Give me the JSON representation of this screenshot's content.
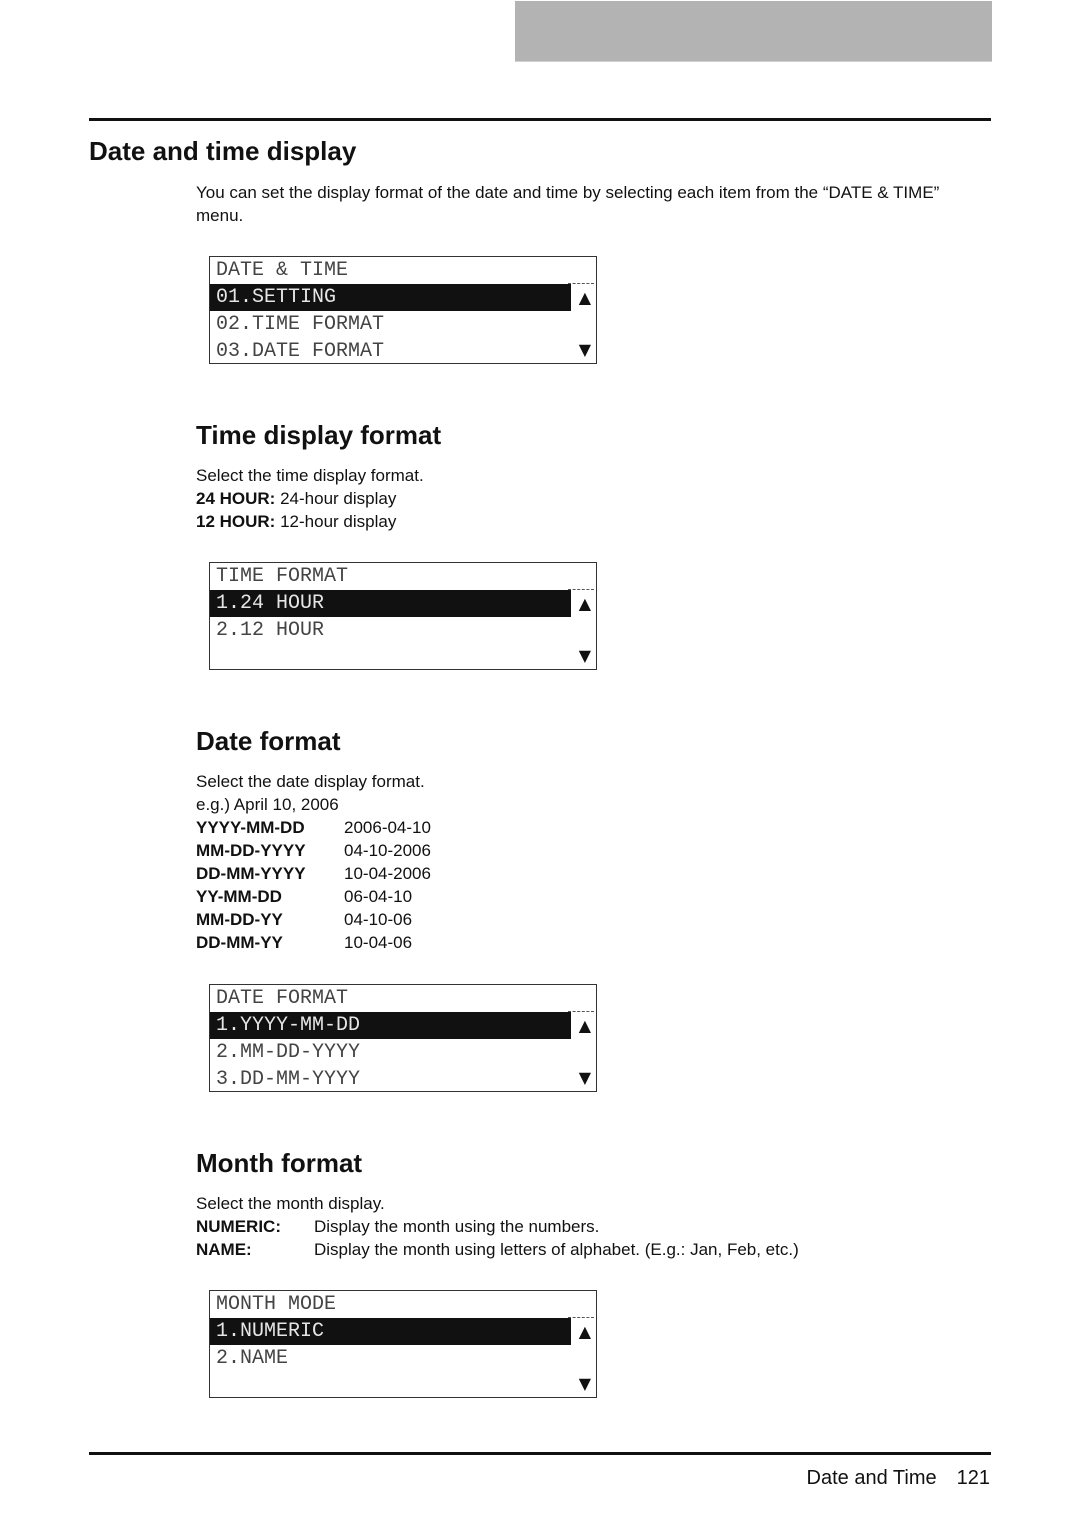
{
  "header": {
    "rule": true
  },
  "section1": {
    "title": "Date and time display",
    "intro": "You can set the display format of the date and time by selecting each item from the “DATE & TIME” menu.",
    "lcd": {
      "title": "DATE & TIME",
      "rows": [
        "01.SETTING",
        "02.TIME FORMAT",
        "03.DATE FORMAT"
      ],
      "selected_index": 0
    }
  },
  "section2": {
    "title": "Time display format",
    "desc": "Select the time display format.",
    "items": [
      {
        "key": "24 HOUR:",
        "value": "24-hour display"
      },
      {
        "key": "12 HOUR:",
        "value": "12-hour display"
      }
    ],
    "lcd": {
      "title": "TIME FORMAT",
      "rows": [
        "1.24 HOUR",
        "2.12 HOUR",
        ""
      ],
      "selected_index": 0
    }
  },
  "section3": {
    "title": "Date format",
    "desc": "Select the date display format.",
    "example": "e.g.) April 10, 2006",
    "items": [
      {
        "key": "YYYY-MM-DD",
        "value": "2006-04-10"
      },
      {
        "key": "MM-DD-YYYY",
        "value": "04-10-2006"
      },
      {
        "key": "DD-MM-YYYY",
        "value": "10-04-2006"
      },
      {
        "key": "YY-MM-DD",
        "value": "06-04-10"
      },
      {
        "key": "MM-DD-YY",
        "value": "04-10-06"
      },
      {
        "key": "DD-MM-YY",
        "value": "10-04-06"
      }
    ],
    "lcd": {
      "title": "DATE FORMAT",
      "rows": [
        "1.YYYY-MM-DD",
        "2.MM-DD-YYYY",
        "3.DD-MM-YYYY"
      ],
      "selected_index": 0
    }
  },
  "section4": {
    "title": "Month format",
    "desc": "Select the month display.",
    "items": [
      {
        "key": "NUMERIC:",
        "value": "Display the month using the numbers."
      },
      {
        "key": "NAME:",
        "value": "Display the month using letters of alphabet. (E.g.: Jan, Feb, etc.)"
      }
    ],
    "lcd": {
      "title": "MONTH MODE",
      "rows": [
        "1.NUMERIC",
        "2.NAME",
        ""
      ],
      "selected_index": 0
    }
  },
  "lcd_icons": {
    "up": "▲",
    "down": "▼"
  },
  "footer": {
    "section": "Date and Time",
    "page": "121"
  }
}
